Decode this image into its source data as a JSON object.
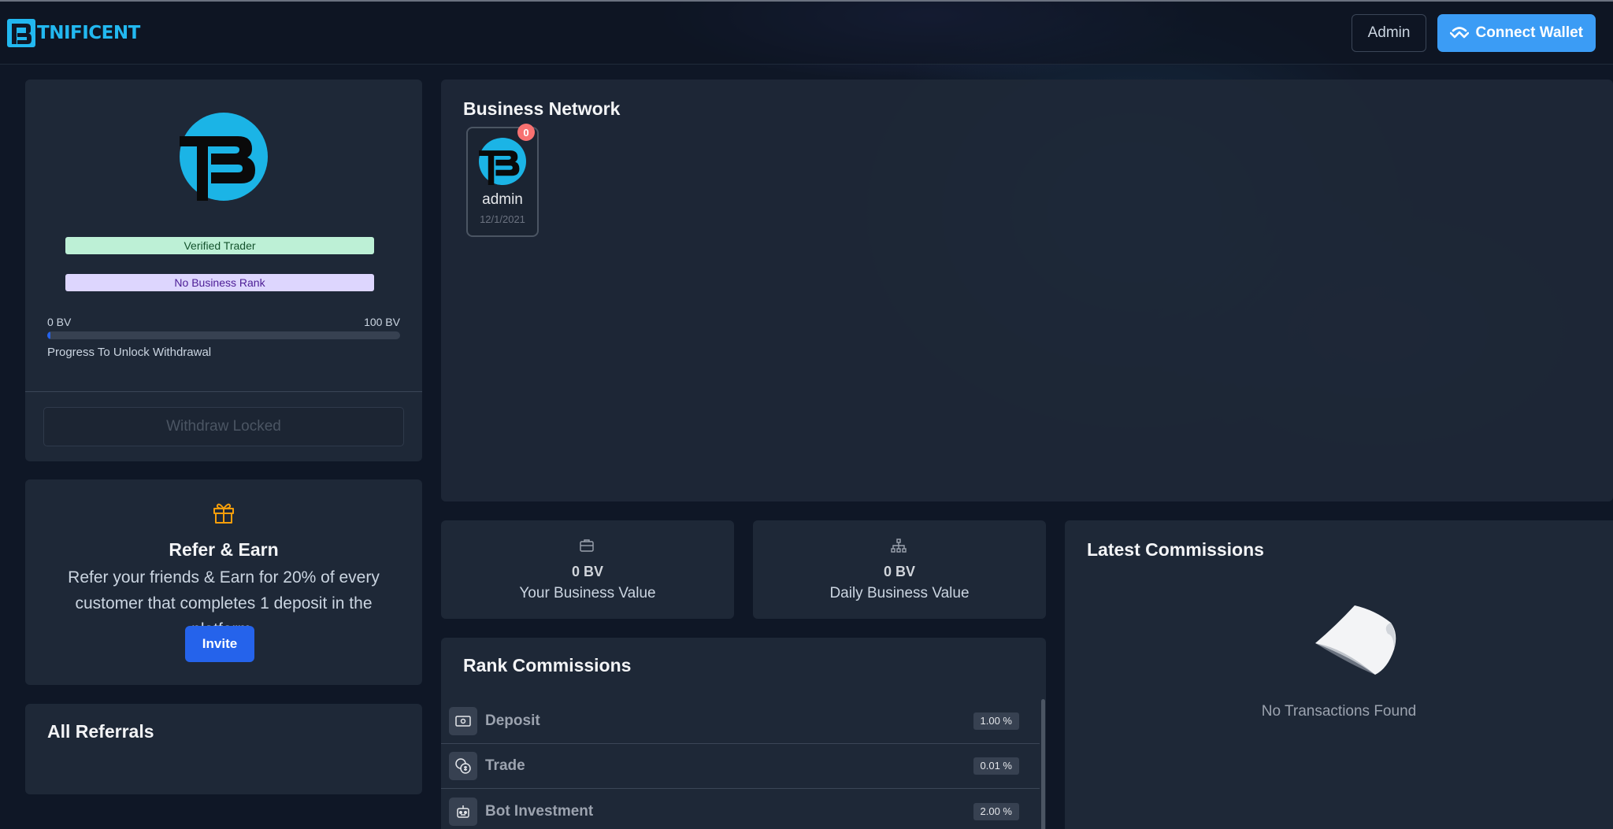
{
  "header": {
    "logo_text": "TNIFICENT",
    "admin_label": "Admin",
    "connect_wallet_label": "Connect Wallet"
  },
  "profile": {
    "verified_badge": "Verified Trader",
    "rank_badge": "No Business Rank",
    "bv_min": "0 BV",
    "bv_max": "100 BV",
    "progress_fraction": 0.01,
    "progress_label": "Progress To Unlock Withdrawal",
    "withdraw_label": "Withdraw Locked"
  },
  "refer": {
    "title": "Refer & Earn",
    "text": "Refer your friends & Earn for 20% of every customer that completes 1 deposit in the platform.",
    "invite_label": "Invite"
  },
  "referrals": {
    "title": "All Referrals"
  },
  "network": {
    "title": "Business Network",
    "node": {
      "name": "admin",
      "date": "12/1/2021",
      "badge_count": "0"
    }
  },
  "stats": {
    "your_bv_value": "0 BV",
    "your_bv_label": "Your Business Value",
    "daily_bv_value": "0 BV",
    "daily_bv_label": "Daily Business Value"
  },
  "rank_commissions": {
    "title": "Rank Commissions",
    "items": [
      {
        "label": "Deposit",
        "percent": "1.00 %",
        "icon": "cash-icon"
      },
      {
        "label": "Trade",
        "percent": "0.01 %",
        "icon": "coins-icon"
      },
      {
        "label": "Bot Investment",
        "percent": "2.00 %",
        "icon": "robot-icon"
      }
    ]
  },
  "latest_commissions": {
    "title": "Latest Commissions",
    "empty_text": "No Transactions Found"
  },
  "colors": {
    "accent": "#3b9cf5",
    "brand": "#22b8f0",
    "primary_button": "#2563eb",
    "badge": "#f87171"
  }
}
